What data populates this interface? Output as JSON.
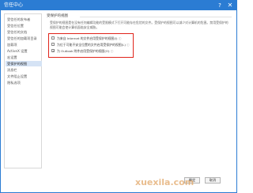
{
  "window": {
    "title": "信任中心",
    "help_glyph": "?",
    "close_glyph": "✕"
  },
  "sidebar": {
    "items": [
      {
        "label": "受信任的发布者"
      },
      {
        "label": "受信任位置"
      },
      {
        "label": "受信任的文档"
      },
      {
        "label": "受信任的加载项目录"
      },
      {
        "label": "加载项"
      },
      {
        "label": "ActiveX 设置"
      },
      {
        "label": "宏设置"
      },
      {
        "label": "受保护的视图",
        "active": true
      },
      {
        "label": "消息栏"
      },
      {
        "label": "文件阻止设置"
      },
      {
        "label": "隐私选项"
      }
    ]
  },
  "main": {
    "section_title": "受保护的视图",
    "description": "受保护的视图是在没有任何编辑功能的受限模式下打开可能存在危险的文件。受保护的视图可以减少对计算机的危害。禁用受保护的视图可能会使计算机面临安全威胁。",
    "options": [
      {
        "label": "为来自 Internet 的文件启用受保护的视图(I)",
        "checked": false
      },
      {
        "label": "为位于可能不安全位置的文件启用受保护的视图(L)",
        "checked": false
      },
      {
        "label": "为 Outlook 附件启用受保护的视图(O)",
        "checked": true
      }
    ],
    "info_glyph": "ⓘ",
    "checkmark": "✓"
  },
  "footer": {
    "ok_label": "确定",
    "cancel_label": "取消"
  },
  "watermark": {
    "text": "xuexila.com"
  },
  "colors": {
    "accent": "#2b7cd3",
    "highlight": "#e0241b",
    "active_item": "#d5e3f5"
  }
}
